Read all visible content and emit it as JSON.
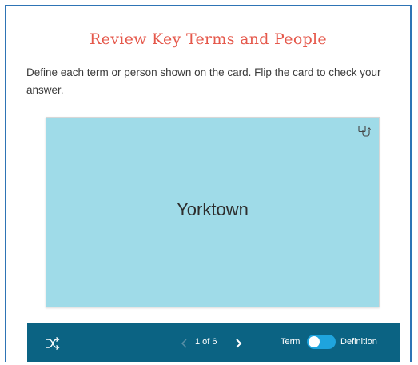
{
  "header": {
    "title": "Review Key Terms and People",
    "instructions": "Define each term or person shown on the card. Flip the card to check your answer."
  },
  "card": {
    "term": "Yorktown",
    "color": "#9fdbe8",
    "flip_icon": "flip-card-icon"
  },
  "toolbar": {
    "shuffle_icon": "shuffle-icon",
    "counter": "1 of 6",
    "term_label": "Term",
    "definition_label": "Definition",
    "toggle_state": "term",
    "color": "#0b6383"
  },
  "colors": {
    "title": "#e5584b",
    "border": "#2e74b5",
    "toggle": "#1fa4dd"
  }
}
